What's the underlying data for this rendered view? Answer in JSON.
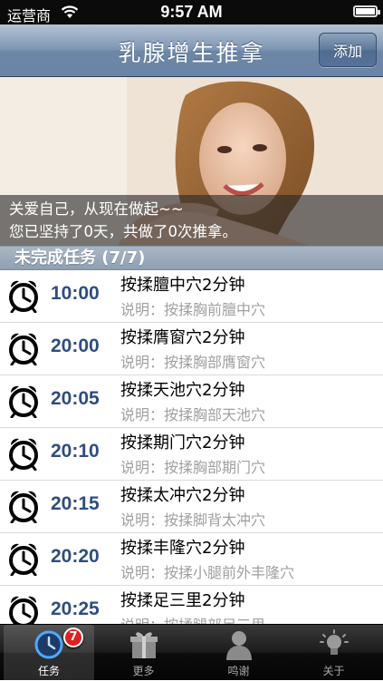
{
  "status_bar": {
    "carrier": "运营商",
    "time": "9:57 AM"
  },
  "nav": {
    "title": "乳腺增生推拿",
    "add_label": "添加"
  },
  "banner": {
    "line1": "关爱自己，从现在做起~~",
    "line2": "您已坚持了0天，共做了0次推拿。"
  },
  "section": {
    "title": "未完成任务 (7/7)"
  },
  "tasks": [
    {
      "time": "10:00",
      "name": "按揉膻中穴2分钟",
      "desc": "说明：按揉胸前膻中穴"
    },
    {
      "time": "20:00",
      "name": "按揉膺窗穴2分钟",
      "desc": "说明：按揉胸部膺窗穴"
    },
    {
      "time": "20:05",
      "name": "按揉天池穴2分钟",
      "desc": "说明：按揉胸部天池穴"
    },
    {
      "time": "20:10",
      "name": "按揉期门穴2分钟",
      "desc": "说明：按揉胸部期门穴"
    },
    {
      "time": "20:15",
      "name": "按揉太冲穴2分钟",
      "desc": "说明：按揉脚背太冲穴"
    },
    {
      "time": "20:20",
      "name": "按揉丰隆穴2分钟",
      "desc": "说明：按揉小腿前外丰隆穴"
    },
    {
      "time": "20:25",
      "name": "按揉足三里2分钟",
      "desc": "说明：按揉腿部足三里"
    }
  ],
  "tabbar": {
    "tabs": [
      {
        "label": "任务",
        "icon": "clock-icon",
        "badge": "7"
      },
      {
        "label": "更多",
        "icon": "gift-icon"
      },
      {
        "label": "鸣谢",
        "icon": "person-icon"
      },
      {
        "label": "关于",
        "icon": "lightbulb-icon"
      }
    ]
  },
  "colors": {
    "nav_bar": "#7e96b3",
    "time_text": "#2f4d7f",
    "badge": "#e02020"
  }
}
